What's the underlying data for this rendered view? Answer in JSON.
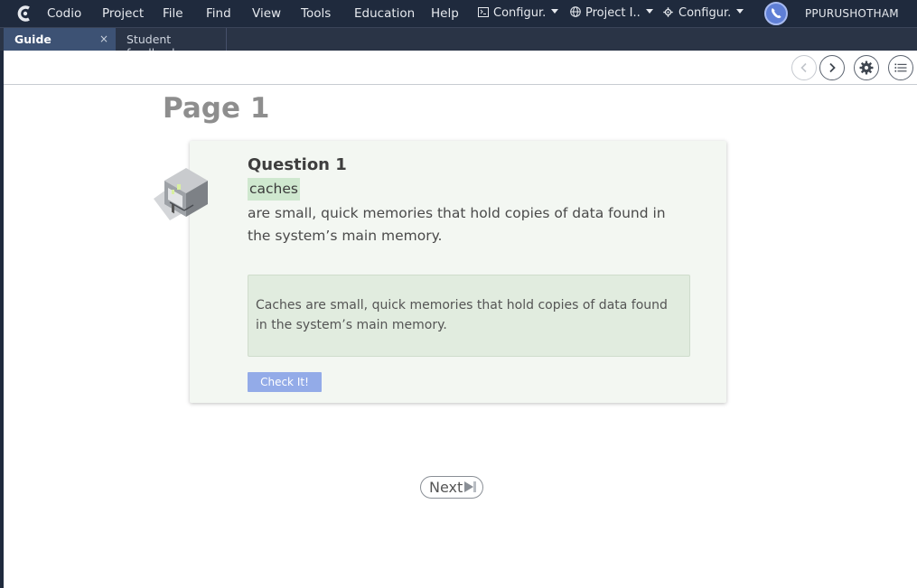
{
  "menubar": {
    "app_name": "Codio",
    "items": [
      "Project",
      "File",
      "Find",
      "View",
      "Tools",
      "Education",
      "Help"
    ],
    "dropdowns": [
      {
        "label": "Configur.",
        "icon": "terminal-icon"
      },
      {
        "label": "Project I..",
        "icon": "globe-icon"
      },
      {
        "label": "Configur.",
        "icon": "gear-icon"
      }
    ],
    "user": "PPURUSHOTHAM",
    "background_color": "#1f2a3d"
  },
  "tabs": [
    {
      "label": "Guide",
      "active": true,
      "closable": true
    },
    {
      "label": "Student feedback",
      "active": false,
      "closable": false
    }
  ],
  "tab_close_glyph": "×",
  "toolbar": {
    "icons": [
      "chevron-left-icon",
      "chevron-right-icon",
      "gear-icon",
      "list-icon"
    ]
  },
  "page": {
    "title": "Page 1"
  },
  "question": {
    "title": "Question 1",
    "answer": "caches",
    "text": " are small, quick memories that hold copies of data found in the system’s main memory.",
    "feedback": "Caches are small, quick memories that hold copies of data found in the system’s main memory.",
    "check_label": "Check It!",
    "check_color": "#93abe8",
    "answer_highlight_color": "#cfe8cf"
  },
  "navigation": {
    "next_label": "Next"
  }
}
